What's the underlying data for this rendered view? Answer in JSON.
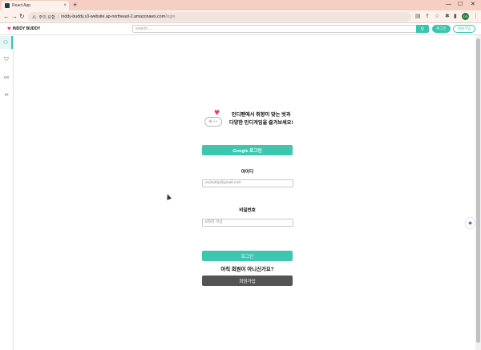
{
  "browser": {
    "tab_title": "React App",
    "tab_close": "×",
    "new_tab": "+",
    "nav": {
      "back": "←",
      "forward": "→",
      "reload": "↻"
    },
    "omnibox": {
      "warning_label": "주의 요함",
      "host": "inddy-buddy.s3-website.ap-northeast-2.amazonaws.com",
      "path": "/login"
    },
    "profile_initials": "CR",
    "window_controls": {
      "minimize": "—",
      "maximize": "☐",
      "close": "✕"
    }
  },
  "header": {
    "logo_text": "INDDY BUDDY",
    "search_placeholder": "search ...",
    "login_label": "로그인",
    "signup_label": "회원가입"
  },
  "hero": {
    "line1": "인디펜에서 취향이 맞는 벗과",
    "line2": "다양한 인디게임을 즐겨보세요!"
  },
  "form": {
    "google_button": "Google 로그인",
    "id_label": "아이디",
    "id_placeholder": "ex)inddy@gmail.com",
    "password_label": "비밀번호",
    "password_placeholder": "8자리 이상",
    "login_button": "로그인",
    "ask_text": "아직 회원이 아니신가요?",
    "signup_button": "회원가입"
  },
  "colors": {
    "accent": "#3dc7b1",
    "heart": "#e83c6e",
    "dark_button": "#545454",
    "tabbar": "#f5cfc3"
  },
  "icons": {
    "sidebar": [
      "user-icon",
      "bookmark-icon",
      "gamepad-icon",
      "link-icon"
    ],
    "header_search": "search-icon"
  }
}
